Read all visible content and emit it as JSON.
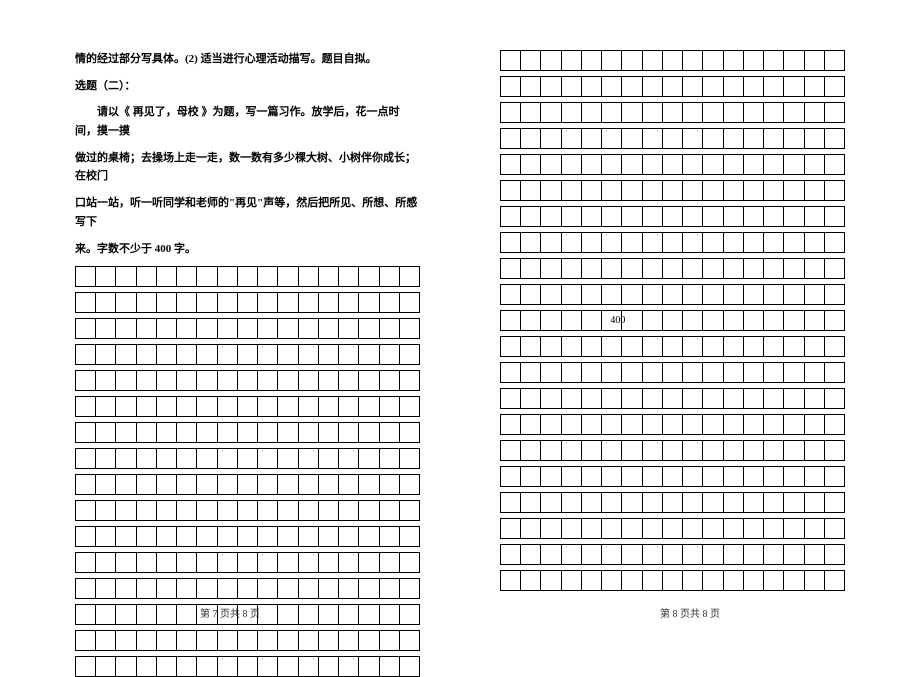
{
  "left": {
    "line1": "情的经过部分写具体。(2) 适当进行心理活动描写。题目自拟。",
    "topic_label": "选题（二）：",
    "para1": "请以《 再见了，母校 》为题，写一篇习作。放学后，花一点时间，摸一摸",
    "para2": "做过的桌椅；去操场上走一走，数一数有多少棵大树、小树伴你成长；在校门",
    "para3": "口站一站，听一听同学和老师的\"再见\"声等，然后把所见、所想、所感写下",
    "para4": "来。字数不少于 400 字。"
  },
  "right": {
    "word_count": "400"
  },
  "footer": {
    "left": "第 7 页共 8 页",
    "right": "第 8 页共 8 页"
  },
  "grid": {
    "cols": 17,
    "left_rows": 16,
    "right_rows": 21
  }
}
